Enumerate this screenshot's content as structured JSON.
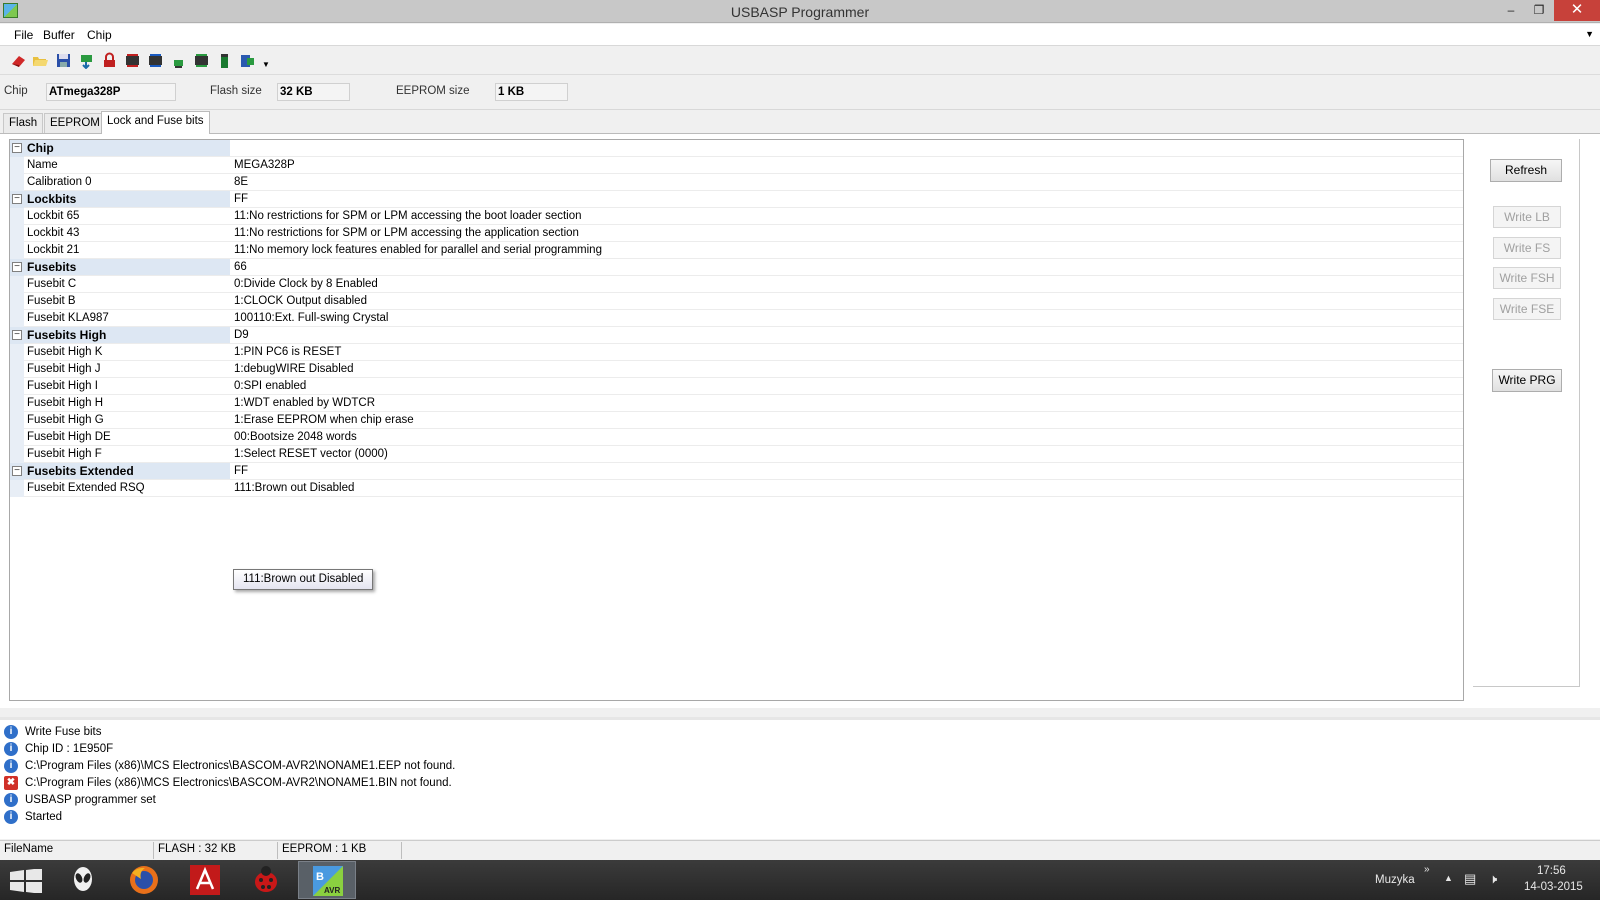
{
  "window": {
    "title": "USBASP Programmer"
  },
  "menu": {
    "items": [
      "File",
      "Buffer",
      "Chip"
    ]
  },
  "chip_info": {
    "chip_label": "Chip",
    "chip_value": "ATmega328P",
    "flash_label": "Flash size",
    "flash_value": "32 KB",
    "eeprom_label": "EEPROM size",
    "eeprom_value": "1 KB"
  },
  "tabs": [
    "Flash",
    "EEPROM",
    "Lock and Fuse bits"
  ],
  "properties": [
    {
      "name": "Chip",
      "value": "",
      "category": true
    },
    {
      "name": "Name",
      "value": "MEGA328P"
    },
    {
      "name": "Calibration 0",
      "value": "8E"
    },
    {
      "name": "Lockbits",
      "value": "FF",
      "category": true
    },
    {
      "name": "Lockbit 65",
      "value": "11:No restrictions for SPM or LPM accessing the boot loader section"
    },
    {
      "name": "Lockbit 43",
      "value": "11:No restrictions for SPM or LPM accessing the application section"
    },
    {
      "name": "Lockbit 21",
      "value": "11:No memory lock features enabled for parallel and serial programming"
    },
    {
      "name": "Fusebits",
      "value": "66",
      "category": true
    },
    {
      "name": "Fusebit C",
      "value": "0:Divide Clock by 8 Enabled"
    },
    {
      "name": "Fusebit B",
      "value": "1:CLOCK Output disabled"
    },
    {
      "name": "Fusebit KLA987",
      "value": "100110:Ext. Full-swing Crystal"
    },
    {
      "name": "Fusebits High",
      "value": "D9",
      "category": true
    },
    {
      "name": "Fusebit High K",
      "value": "1:PIN PC6 is RESET"
    },
    {
      "name": "Fusebit High J",
      "value": "1:debugWIRE Disabled"
    },
    {
      "name": "Fusebit High I",
      "value": "0:SPI enabled"
    },
    {
      "name": "Fusebit High H",
      "value": "1:WDT enabled by WDTCR"
    },
    {
      "name": "Fusebit High G",
      "value": "1:Erase EEPROM when chip erase"
    },
    {
      "name": "Fusebit High DE",
      "value": "00:Bootsize 2048 words"
    },
    {
      "name": "Fusebit High F",
      "value": "1:Select RESET vector (0000)"
    },
    {
      "name": "Fusebits Extended",
      "value": "FF",
      "category": true
    },
    {
      "name": "Fusebit Extended RSQ",
      "value": "111:Brown out Disabled"
    }
  ],
  "tooltip": "111:Brown out Disabled",
  "buttons": {
    "refresh": "Refresh",
    "write_lb": "Write LB",
    "write_fs": "Write FS",
    "write_fsh": "Write FSH",
    "write_fse": "Write FSE",
    "write_prg": "Write PRG"
  },
  "log": [
    {
      "type": "info",
      "text": "Write Fuse bits"
    },
    {
      "type": "info",
      "text": "Chip ID : 1E950F"
    },
    {
      "type": "info",
      "text": "C:\\Program Files (x86)\\MCS Electronics\\BASCOM-AVR2\\NONAME1.EEP not found."
    },
    {
      "type": "error",
      "text": "C:\\Program Files (x86)\\MCS Electronics\\BASCOM-AVR2\\NONAME1.BIN not found."
    },
    {
      "type": "info",
      "text": "USBASP programmer set"
    },
    {
      "type": "info",
      "text": "Started"
    }
  ],
  "status": {
    "filename": "FileName",
    "flash": "FLASH : 32 KB",
    "eeprom": "EEPROM : 1 KB"
  },
  "taskbar": {
    "apps": [
      "alien-app-icon",
      "firefox-icon",
      "acrobat-icon",
      "ladybug-app-icon",
      "bascom-avr-icon"
    ],
    "toolbar_label": "Muzyka",
    "time": "17:56",
    "date": "14-03-2015"
  }
}
